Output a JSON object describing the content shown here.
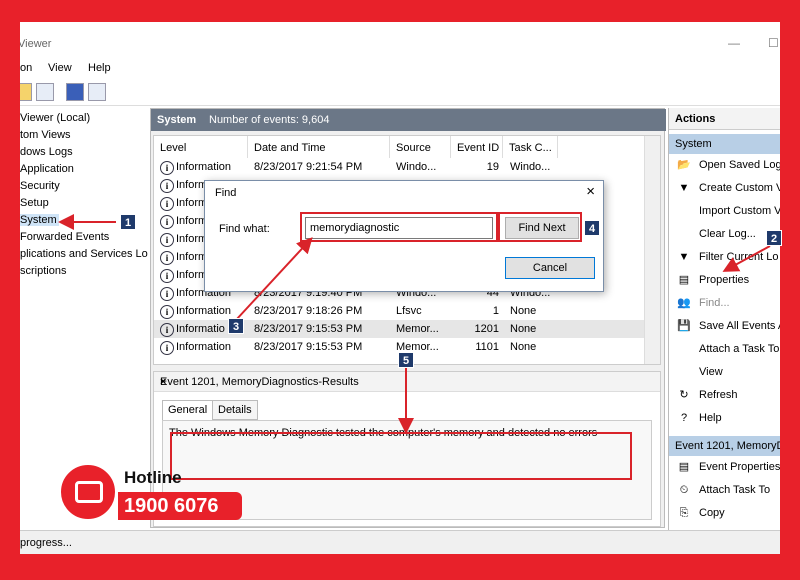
{
  "window": {
    "title": "Viewer",
    "min": "—",
    "max": "☐"
  },
  "menu": [
    "on",
    "View",
    "Help"
  ],
  "tree": [
    {
      "label": "Viewer (Local)"
    },
    {
      "label": "tom Views"
    },
    {
      "label": "dows Logs"
    },
    {
      "label": "Application"
    },
    {
      "label": "Security"
    },
    {
      "label": "Setup"
    },
    {
      "label": "System"
    },
    {
      "label": "Forwarded Events"
    },
    {
      "label": "plications and Services Lo"
    },
    {
      "label": "scriptions"
    }
  ],
  "events_header": {
    "title": "System",
    "count": "Number of events: 9,604"
  },
  "columns": [
    "Level",
    "Date and Time",
    "Source",
    "Event ID",
    "Task C..."
  ],
  "rows": [
    {
      "level": "Information",
      "date": "8/23/2017 9:21:54 PM",
      "source": "Windo...",
      "id": "19",
      "task": "Windo..."
    },
    {
      "level": "Inform",
      "date": "",
      "source": "",
      "id": "",
      "task": ""
    },
    {
      "level": "Inform",
      "date": "",
      "source": "",
      "id": "",
      "task": ""
    },
    {
      "level": "Inform",
      "date": "",
      "source": "",
      "id": "",
      "task": ""
    },
    {
      "level": "Inform",
      "date": "",
      "source": "",
      "id": "",
      "task": ""
    },
    {
      "level": "Inform",
      "date": "",
      "source": "",
      "id": "",
      "task": ""
    },
    {
      "level": "Inform",
      "date": "",
      "source": "",
      "id": "",
      "task": ""
    },
    {
      "level": "Information",
      "date": "8/23/2017 9:19:40 PM",
      "source": "Windo...",
      "id": "44",
      "task": "Windo..."
    },
    {
      "level": "Information",
      "date": "8/23/2017 9:18:26 PM",
      "source": "Lfsvc",
      "id": "1",
      "task": "None"
    },
    {
      "level": "Informatio",
      "date": "8/23/2017 9:15:53 PM",
      "source": "Memor...",
      "id": "1201",
      "task": "None"
    },
    {
      "level": "Information",
      "date": "8/23/2017 9:15:53 PM",
      "source": "Memor...",
      "id": "1101",
      "task": "None"
    }
  ],
  "detail": {
    "title": "Event 1201, MemoryDiagnostics-Results",
    "close": "×",
    "tabs": [
      "General",
      "Details"
    ],
    "message": "The Windows Memory Diagnostic tested the computer's memory and detected no errors"
  },
  "find_dialog": {
    "title": "Find",
    "close": "×",
    "label": "Find what:",
    "value": "memorydiagnostic",
    "find_next": "Find Next",
    "cancel": "Cancel"
  },
  "actions": {
    "header": "Actions",
    "group1": "System",
    "items1": [
      {
        "label": "Open Saved Log",
        "icon": "📂"
      },
      {
        "label": "Create Custom V",
        "icon": "▼"
      },
      {
        "label": "Import Custom V",
        "icon": ""
      },
      {
        "label": "Clear Log...",
        "icon": ""
      },
      {
        "label": "Filter Current Lo",
        "icon": "▼"
      },
      {
        "label": "Properties",
        "icon": "▤"
      },
      {
        "label": "Find...",
        "icon": "👥"
      },
      {
        "label": "Save All Events A",
        "icon": "💾"
      },
      {
        "label": "Attach a Task To",
        "icon": ""
      },
      {
        "label": "View",
        "icon": ""
      },
      {
        "label": "Refresh",
        "icon": "↻"
      },
      {
        "label": "Help",
        "icon": "?"
      }
    ],
    "group2": "Event 1201, MemoryD",
    "items2": [
      {
        "label": "Event Properties",
        "icon": "▤"
      },
      {
        "label": "Attach Task To",
        "icon": "⏲"
      },
      {
        "label": "Copy",
        "icon": "⎘"
      }
    ]
  },
  "status": "progress...",
  "callouts": [
    "1",
    "2",
    "3",
    "4",
    "5"
  ],
  "hotline": {
    "title": "Hotline",
    "number": "1900 6076"
  },
  "colors": {
    "frame": "#e8212a",
    "callout": "#1f3a6b",
    "highlight": "#d9232a"
  }
}
